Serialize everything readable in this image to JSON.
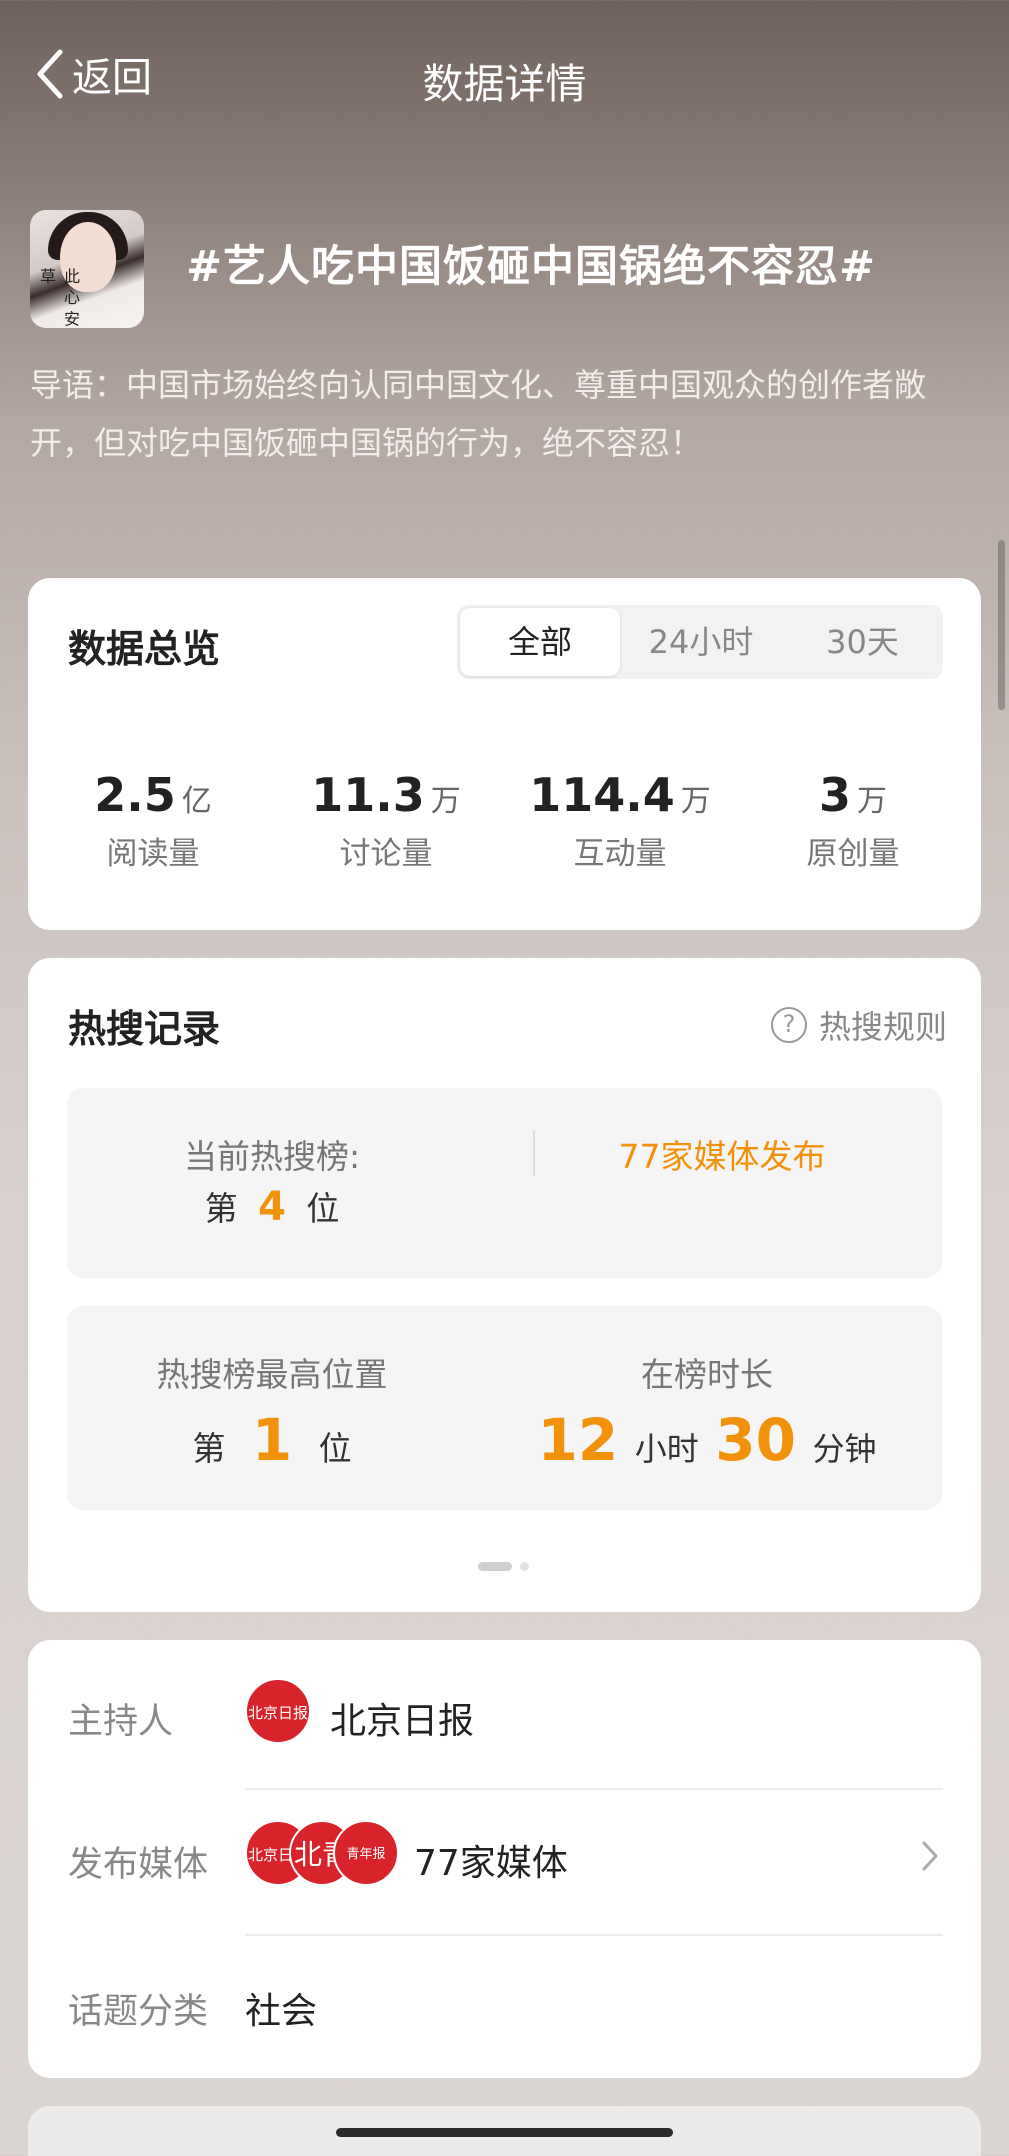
{
  "header": {
    "back_label": "返回",
    "title": "数据详情"
  },
  "topic": {
    "cover_caption": "此 心 安 草",
    "name": "#艺人吃中国饭砸中国锅绝不容忍#",
    "intro": "导语：中国市场始终向认同中国文化、尊重中国观众的创作者敞开，但对吃中国饭砸中国锅的行为，绝不容忍！"
  },
  "overview": {
    "title": "数据总览",
    "tabs": [
      "全部",
      "24小时",
      "30天"
    ],
    "active_tab": "全部",
    "stats": [
      {
        "value": "2.5",
        "unit": "亿",
        "label": "阅读量"
      },
      {
        "value": "11.3",
        "unit": "万",
        "label": "讨论量"
      },
      {
        "value": "114.4",
        "unit": "万",
        "label": "互动量"
      },
      {
        "value": "3",
        "unit": "万",
        "label": "原创量"
      }
    ]
  },
  "hot": {
    "title": "热搜记录",
    "rules_label": "热搜规则",
    "current_label": "当前热搜榜:",
    "current_prefix": "第",
    "current_rank": "4",
    "current_suffix": "位",
    "media_release": "77家媒体发布",
    "peak_label": "热搜榜最高位置",
    "peak_prefix": "第",
    "peak_rank": "1",
    "peak_suffix": "位",
    "duration_label": "在榜时长",
    "duration_hours": "12",
    "hours_unit": "小时",
    "duration_minutes": "30",
    "minutes_unit": "分钟",
    "page_count": 2,
    "page_active": 0
  },
  "info": {
    "host_label": "主持人",
    "host_logo_text": "北京日报",
    "host_name": "北京日报",
    "media_label": "发布媒体",
    "media_logos": [
      "北京日报",
      "北青",
      "青年报"
    ],
    "media_value": "77家媒体",
    "category_label": "话题分类",
    "category_value": "社会"
  },
  "colors": {
    "accent": "#f2910a",
    "logo_red": "#d8232a"
  }
}
